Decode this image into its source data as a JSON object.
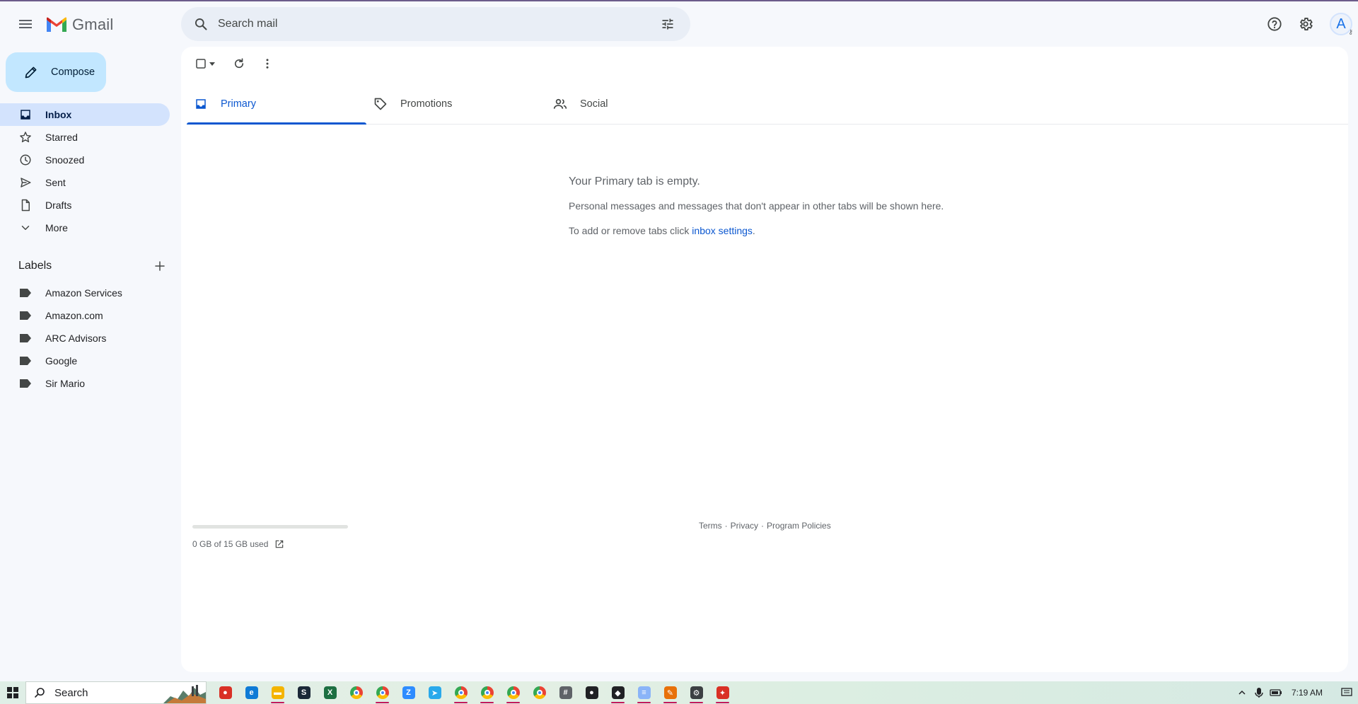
{
  "app": {
    "name": "Gmail"
  },
  "search": {
    "placeholder": "Search mail"
  },
  "compose": {
    "label": "Compose"
  },
  "nav": [
    {
      "label": "Inbox",
      "icon": "inbox-icon",
      "active": true
    },
    {
      "label": "Starred",
      "icon": "star-icon"
    },
    {
      "label": "Snoozed",
      "icon": "clock-icon"
    },
    {
      "label": "Sent",
      "icon": "send-icon"
    },
    {
      "label": "Drafts",
      "icon": "draft-icon"
    },
    {
      "label": "More",
      "icon": "chevron-down-icon"
    }
  ],
  "labels": {
    "title": "Labels",
    "items": [
      {
        "label": "Amazon Services"
      },
      {
        "label": "Amazon.com"
      },
      {
        "label": "ARC Advisors"
      },
      {
        "label": "Google"
      },
      {
        "label": "Sir Mario"
      }
    ]
  },
  "tabs": [
    {
      "label": "Primary",
      "icon": "inbox-icon",
      "active": true
    },
    {
      "label": "Promotions",
      "icon": "tag-icon"
    },
    {
      "label": "Social",
      "icon": "people-icon"
    }
  ],
  "empty": {
    "title": "Your Primary tab is empty.",
    "desc": "Personal messages and messages that don't appear in other tabs will be shown here.",
    "line_prefix": "To add or remove tabs click ",
    "link": "inbox settings",
    "line_suffix": "."
  },
  "storage": {
    "text": "0 GB of 15 GB used",
    "used_fraction": 0.0
  },
  "footer": {
    "terms": "Terms",
    "sep": "·",
    "privacy": "Privacy",
    "policies": "Program Policies"
  },
  "header": {
    "avatar_letter": "A"
  },
  "taskbar": {
    "search_label": "Search",
    "time": "7:19 AM",
    "apps": [
      {
        "name": "app-red-icon",
        "color": "#d93025",
        "open": false
      },
      {
        "name": "edge-icon",
        "color": "#0f7bd6",
        "open": false
      },
      {
        "name": "file-explorer-icon",
        "color": "#f4b400",
        "open": true
      },
      {
        "name": "steam-icon",
        "color": "#1b2838",
        "open": false
      },
      {
        "name": "excel-icon",
        "color": "#1d6f42",
        "open": false
      },
      {
        "name": "chrome-icon",
        "color": "#34a853",
        "open": false
      },
      {
        "name": "chrome-profile-icon",
        "color": "#34a853",
        "open": true
      },
      {
        "name": "zoom-icon",
        "color": "#2d8cff",
        "open": false
      },
      {
        "name": "telegram-icon",
        "color": "#29a9eb",
        "open": false
      },
      {
        "name": "chrome-profile-icon",
        "color": "#ea4335",
        "open": true
      },
      {
        "name": "chrome-profile-icon",
        "color": "#ea4335",
        "open": true
      },
      {
        "name": "chrome-profile-icon",
        "color": "#ea4335",
        "open": true
      },
      {
        "name": "chrome-profile-icon",
        "color": "#34a853",
        "open": false
      },
      {
        "name": "calculator-icon",
        "color": "#5f6368",
        "open": false
      },
      {
        "name": "app-dark-icon",
        "color": "#202124",
        "open": false
      },
      {
        "name": "app-notes-icon",
        "color": "#202124",
        "open": true
      },
      {
        "name": "notepad-icon",
        "color": "#8ab4f8",
        "open": true
      },
      {
        "name": "paint-icon",
        "color": "#e8710a",
        "open": true
      },
      {
        "name": "settings-icon",
        "color": "#3c4043",
        "open": true
      },
      {
        "name": "app-active-icon",
        "color": "#d93025",
        "open": true
      }
    ]
  },
  "colors": {
    "accent": "#0b57d0",
    "compose_bg": "#c2e7ff",
    "active_nav_bg": "#d3e3fd",
    "app_bg": "#f6f8fc"
  }
}
